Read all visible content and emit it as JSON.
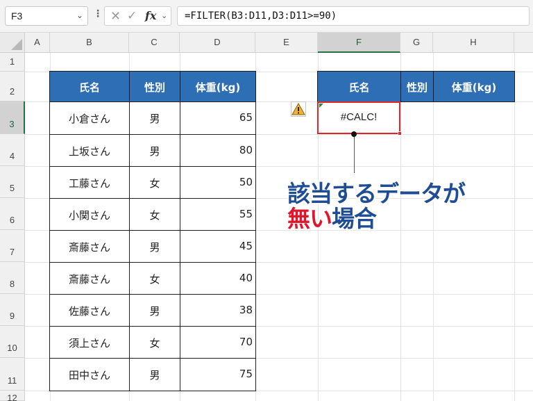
{
  "formula_bar": {
    "name_box": "F3",
    "fx_label": "fx",
    "formula": "=FILTER(B3:D11,D3:D11>=90)"
  },
  "columns": [
    "A",
    "B",
    "C",
    "D",
    "E",
    "F",
    "G",
    "H"
  ],
  "rows": [
    "1",
    "2",
    "3",
    "4",
    "5",
    "6",
    "7",
    "8",
    "9",
    "10",
    "11",
    "12"
  ],
  "selected_cell": {
    "column": "F",
    "row": "3"
  },
  "source_table": {
    "headers": [
      "氏名",
      "性別",
      "体重(kg)"
    ],
    "rows": [
      [
        "小倉さん",
        "男",
        "65"
      ],
      [
        "上坂さん",
        "男",
        "80"
      ],
      [
        "工藤さん",
        "女",
        "50"
      ],
      [
        "小関さん",
        "女",
        "55"
      ],
      [
        "斎藤さん",
        "男",
        "45"
      ],
      [
        "斎藤さん",
        "女",
        "40"
      ],
      [
        "佐藤さん",
        "男",
        "38"
      ],
      [
        "須上さん",
        "女",
        "70"
      ],
      [
        "田中さん",
        "男",
        "75"
      ]
    ]
  },
  "result_table": {
    "headers": [
      "氏名",
      "性別",
      "体重(kg)"
    ],
    "result": "#CALC!"
  },
  "callout": {
    "line1": "該当するデータが",
    "line2_red": "無い",
    "line2_blue": "場合"
  },
  "colors": {
    "header_fill": "#2e6eb5",
    "selection_border": "#e0242a",
    "callout_blue": "#1e4c95",
    "callout_red": "#e0142a"
  }
}
